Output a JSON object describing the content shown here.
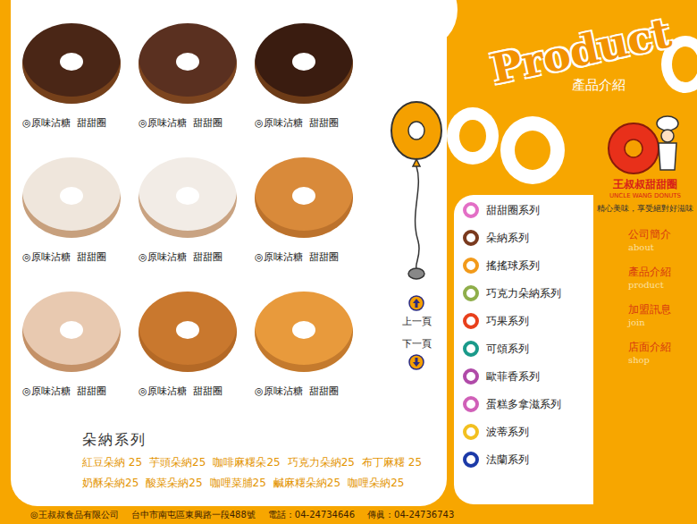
{
  "brand": {
    "title_en": "Product",
    "title_zh": "產品介紹",
    "logo_name": "王叔叔甜甜圈",
    "logo_en": "UNCLE WANG DONUTS",
    "slogan": "精心美味，享受絕對好滋味"
  },
  "products": [
    {
      "caption": "◎原味沾糖  甜甜圈",
      "color": "#4a2616"
    },
    {
      "caption": "◎原味沾糖  甜甜圈",
      "color": "#5a3020"
    },
    {
      "caption": "◎原味沾糖  甜甜圈",
      "color": "#3a1c10"
    },
    {
      "caption": "◎原味沾糖  甜甜圈",
      "color": "#efe6dc"
    },
    {
      "caption": "◎原味沾糖  甜甜圈",
      "color": "#f2ece6"
    },
    {
      "caption": "◎原味沾糖  甜甜圈",
      "color": "#d98a3a"
    },
    {
      "caption": "◎原味沾糖  甜甜圈",
      "color": "#e8c9b0"
    },
    {
      "caption": "◎原味沾糖  甜甜圈",
      "color": "#c9782e"
    },
    {
      "caption": "◎原味沾糖  甜甜圈",
      "color": "#e89a3c"
    }
  ],
  "pager": {
    "prev": "上一頁",
    "next": "下一頁"
  },
  "series_title": "朵納系列",
  "flavors": [
    "紅豆朵納 25",
    "芋頭朵納25",
    "咖啡麻糬朵25",
    "巧克力朵納25",
    "布丁麻糬 25",
    "奶酥朵納25",
    "酸菜朵納25",
    "咖哩菜脯25",
    "鹹麻糬朵納25",
    "咖哩朵納25"
  ],
  "categories": [
    {
      "label": "甜甜圈系列",
      "color": "#e36fc6"
    },
    {
      "label": "朵納系列",
      "color": "#7a3a1e"
    },
    {
      "label": "搖搖球系列",
      "color": "#f29a1a"
    },
    {
      "label": "巧克力朵納系列",
      "color": "#8fae4a"
    },
    {
      "label": "巧果系列",
      "color": "#e8401c"
    },
    {
      "label": "可頌系列",
      "color": "#1a9a8a"
    },
    {
      "label": "歐菲香系列",
      "color": "#b04aa8"
    },
    {
      "label": "蛋糕多拿滋系列",
      "color": "#d060b8"
    },
    {
      "label": "波蒂系列",
      "color": "#f2c020"
    },
    {
      "label": "法蘭系列",
      "color": "#1c3aa8"
    }
  ],
  "nav": [
    {
      "zh": "公司簡介",
      "en": "about"
    },
    {
      "zh": "產品介紹",
      "en": "product"
    },
    {
      "zh": "加盟訊息",
      "en": "join"
    },
    {
      "zh": "店面介紹",
      "en": "shop"
    }
  ],
  "footer": {
    "company": "◎王叔叔食品有限公司",
    "address": "台中市南屯區東興路一段488號",
    "phone": "電話：04-24734646",
    "fax": "傳眞：04-24736743"
  }
}
